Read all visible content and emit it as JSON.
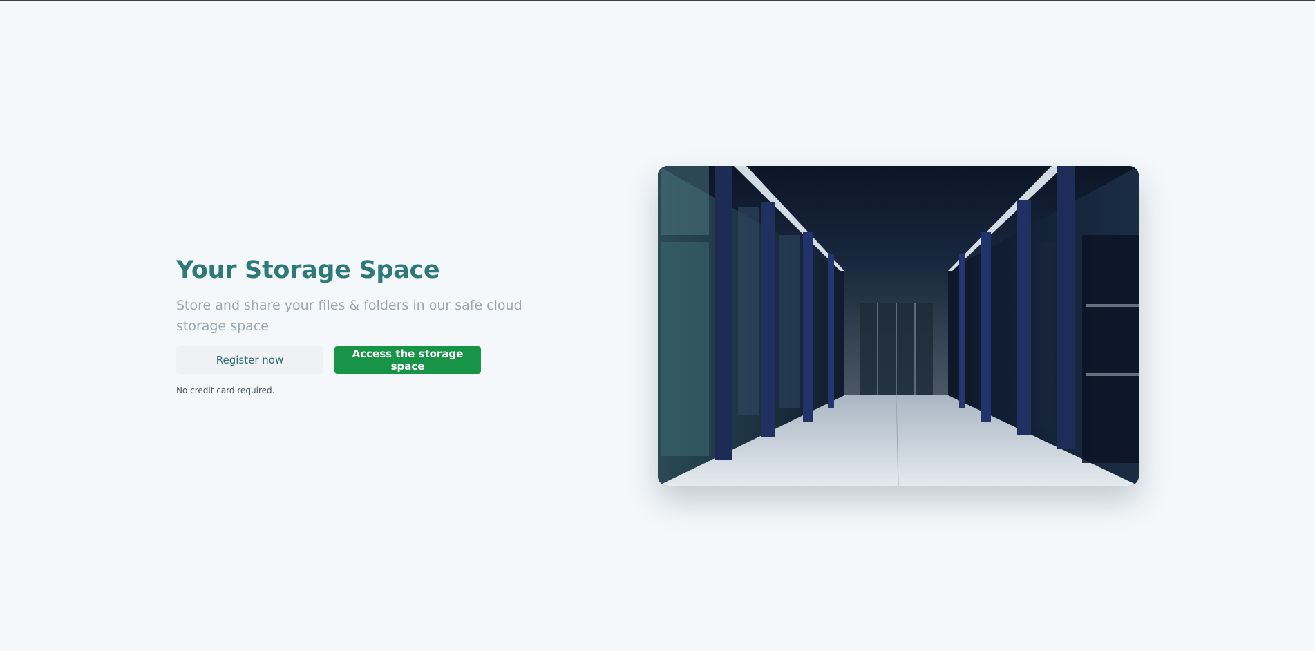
{
  "hero": {
    "title": "Your Storage Space",
    "subtitle": "Store and share your files & folders in our safe cloud storage space",
    "register_label": "Register now",
    "access_label": "Access the storage space",
    "note": "No credit card required."
  },
  "image": {
    "description_icon": "server-hallway-photo"
  },
  "colors": {
    "background": "#f4f8fb",
    "title": "#2e7a7b",
    "subtitle": "#9aa6b2",
    "primary_button": "#189447",
    "secondary_button": "#eff1f3",
    "secondary_text": "#2f6c73"
  }
}
